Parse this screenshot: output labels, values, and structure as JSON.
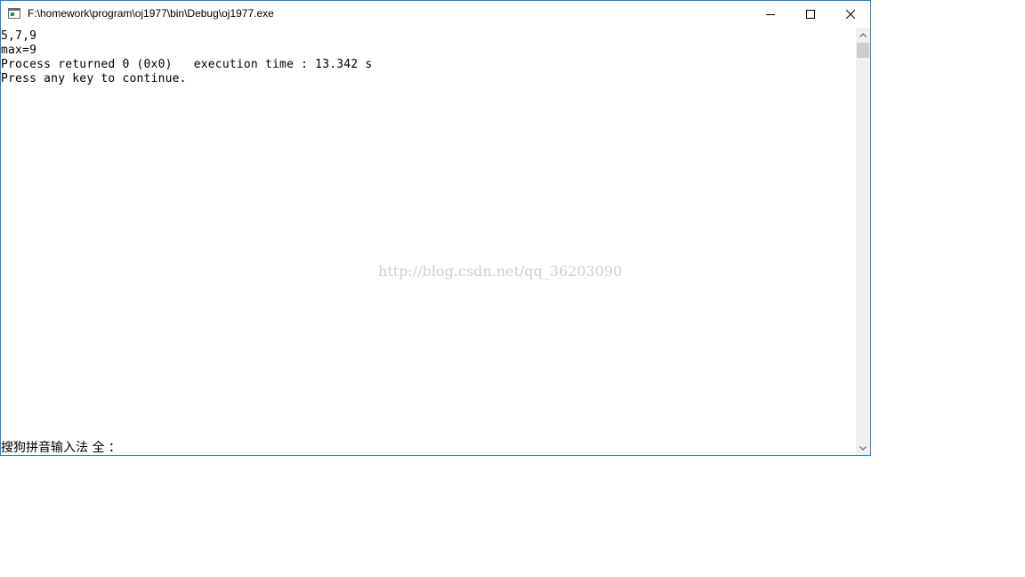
{
  "window": {
    "title": "F:\\homework\\program\\oj1977\\bin\\Debug\\oj1977.exe",
    "icon": "console-app-icon",
    "border_color": "#1883d7"
  },
  "controls": {
    "minimize": "minimize-icon",
    "maximize": "maximize-icon",
    "close": "close-icon"
  },
  "console": {
    "lines": [
      "5,7,9",
      "max=9",
      "Process returned 0 (0x0)   execution time : 13.342 s",
      "Press any key to continue."
    ],
    "ime_status": "搜狗拼音输入法 全 ："
  },
  "watermark": "http://blog.csdn.net/qq_36203090"
}
